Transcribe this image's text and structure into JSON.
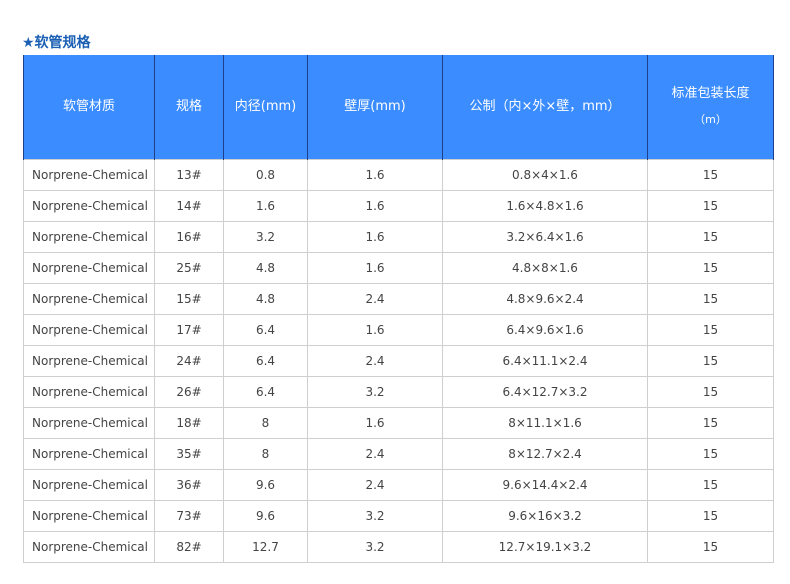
{
  "section_title": "★软管规格",
  "table": {
    "headers": {
      "material": "软管材质",
      "spec": "规格",
      "inner_diameter": "内径(mm)",
      "wall_thickness": "壁厚(mm)",
      "metric": "公制（内×外×壁，mm）",
      "package_length": "标准包装长度",
      "package_length_unit": "（m）"
    },
    "rows": [
      [
        "Norprene-Chemical",
        "13#",
        "0.8",
        "1.6",
        "0.8×4×1.6",
        "15"
      ],
      [
        "Norprene-Chemical",
        "14#",
        "1.6",
        "1.6",
        "1.6×4.8×1.6",
        "15"
      ],
      [
        "Norprene-Chemical",
        "16#",
        "3.2",
        "1.6",
        "3.2×6.4×1.6",
        "15"
      ],
      [
        "Norprene-Chemical",
        "25#",
        "4.8",
        "1.6",
        "4.8×8×1.6",
        "15"
      ],
      [
        "Norprene-Chemical",
        "15#",
        "4.8",
        "2.4",
        "4.8×9.6×2.4",
        "15"
      ],
      [
        "Norprene-Chemical",
        "17#",
        "6.4",
        "1.6",
        "6.4×9.6×1.6",
        "15"
      ],
      [
        "Norprene-Chemical",
        "24#",
        "6.4",
        "2.4",
        "6.4×11.1×2.4",
        "15"
      ],
      [
        "Norprene-Chemical",
        "26#",
        "6.4",
        "3.2",
        "6.4×12.7×3.2",
        "15"
      ],
      [
        "Norprene-Chemical",
        "18#",
        "8",
        "1.6",
        "8×11.1×1.6",
        "15"
      ],
      [
        "Norprene-Chemical",
        "35#",
        "8",
        "2.4",
        "8×12.7×2.4",
        "15"
      ],
      [
        "Norprene-Chemical",
        "36#",
        "9.6",
        "2.4",
        "9.6×14.4×2.4",
        "15"
      ],
      [
        "Norprene-Chemical",
        "73#",
        "9.6",
        "3.2",
        "9.6×16×3.2",
        "15"
      ],
      [
        "Norprene-Chemical",
        "82#",
        "12.7",
        "3.2",
        "12.7×19.1×3.2",
        "15"
      ]
    ]
  },
  "colors": {
    "header_bg": "#3b8cff",
    "header_text": "#ffffff",
    "title_text": "#1a5fb4",
    "cell_text": "#444444",
    "grid_line": "#cfcfcf"
  }
}
